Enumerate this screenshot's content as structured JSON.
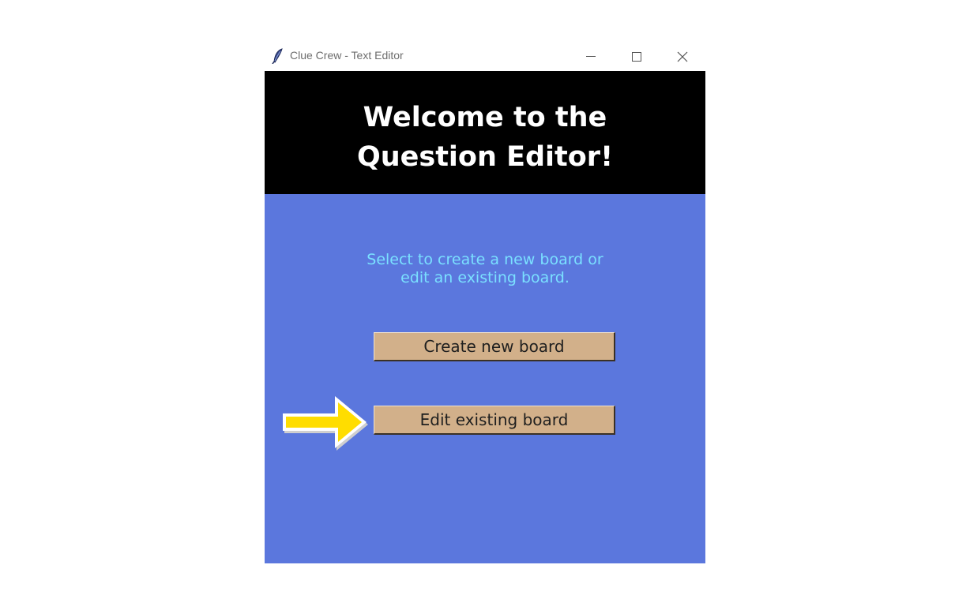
{
  "window": {
    "title": "Clue Crew - Text Editor",
    "app_icon": "feather-icon",
    "controls": [
      "minimize-icon",
      "maximize-icon",
      "close-icon"
    ]
  },
  "header": {
    "title": "Welcome to the\nQuestion Editor!"
  },
  "main": {
    "prompt": "Select to create a new board or\nedit an existing board.",
    "create_button": "Create new board",
    "edit_button": "Edit existing board"
  },
  "annotation": {
    "arrow": "yellow-arrow-icon"
  },
  "colors": {
    "header_bg": "#000000",
    "body_bg": "#5b77dd",
    "prompt_text": "#7ae0ff",
    "button_bg": "#d2b08a",
    "arrow": "#ffdd00"
  }
}
